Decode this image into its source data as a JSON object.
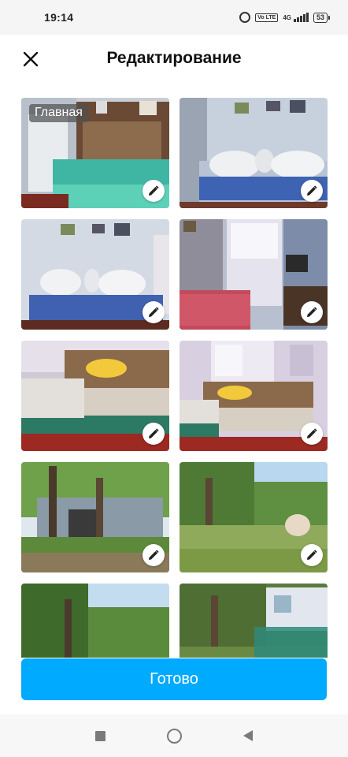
{
  "status_bar": {
    "time": "19:14",
    "network": "4G",
    "volte": "Vo LTE",
    "battery": "53",
    "icons": [
      "alarm-icon",
      "volte-icon",
      "signal-icon",
      "battery-icon"
    ]
  },
  "header": {
    "title": "Редактирование",
    "close_icon": "close-icon"
  },
  "photos": [
    {
      "badge": "Главная",
      "edit_icon": "pencil-icon"
    },
    {
      "edit_icon": "pencil-icon"
    },
    {
      "edit_icon": "pencil-icon"
    },
    {
      "edit_icon": "pencil-icon"
    },
    {
      "edit_icon": "pencil-icon"
    },
    {
      "edit_icon": "pencil-icon"
    },
    {
      "edit_icon": "pencil-icon"
    },
    {
      "edit_icon": "pencil-icon"
    },
    {},
    {}
  ],
  "done_button": {
    "label": "Готово",
    "color": "#00aaff"
  },
  "nav_bar": {
    "icons": [
      "recents-square-icon",
      "home-circle-icon",
      "back-triangle-icon"
    ]
  }
}
